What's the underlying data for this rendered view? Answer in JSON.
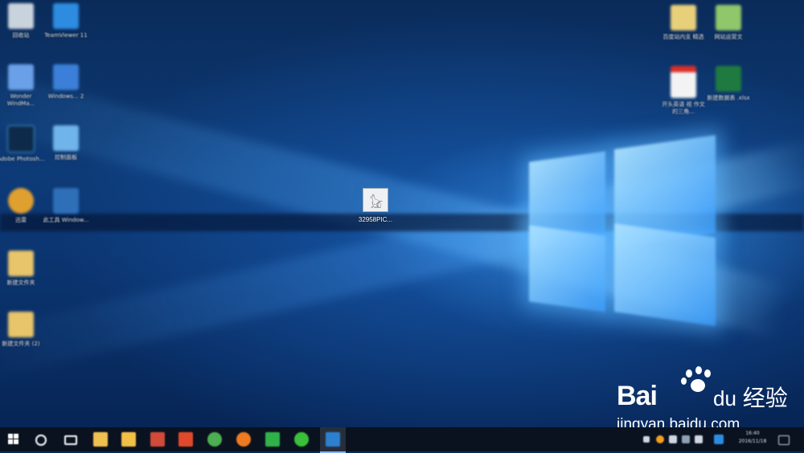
{
  "desktop": {
    "center_icon": {
      "label": "32958PIC..."
    },
    "left_icons": [
      {
        "label": "回收站",
        "icon": "recycle-bin-icon",
        "color": "#c9d3dd"
      },
      {
        "label": "TeamViewer 11",
        "icon": "teamviewer-icon",
        "color": "#2d8ce0"
      },
      {
        "label": "Wonder WindMa...",
        "icon": "app-icon",
        "color": "#6aa0e8"
      },
      {
        "label": "Windows... 2",
        "icon": "app-icon",
        "color": "#3b7fd8"
      },
      {
        "label": "Adobe Photosh...",
        "icon": "photoshop-icon",
        "color": "#0e2a4a"
      },
      {
        "label": "控制面板",
        "icon": "control-panel-icon",
        "color": "#6fb4ea"
      },
      {
        "label": "迅雷",
        "icon": "bird-icon",
        "color": "#e0a030"
      },
      {
        "label": "此工具 Window...",
        "icon": "app-icon",
        "color": "#2f6fb8"
      },
      {
        "label": "新建文件夹",
        "icon": "folder-icon",
        "color": "#e8c46a"
      },
      {
        "label": "新建文件夹 (2)",
        "icon": "folder-icon",
        "color": "#e8c46a"
      }
    ],
    "right_icons": [
      {
        "label": "百度站内支 精选",
        "icon": "file-icon",
        "color": "#e8cf7a"
      },
      {
        "label": "网站运营文",
        "icon": "file-icon",
        "color": "#8fc76a"
      },
      {
        "label": "开头英语 视 作文的三角...",
        "icon": "pdf-icon",
        "color": "#d8302a"
      },
      {
        "label": "新建数据表 .xlsx",
        "icon": "excel-icon",
        "color": "#1f7a40"
      }
    ]
  },
  "taskbar": {
    "apps": [
      {
        "name": "start-button",
        "color": "#ffffff"
      },
      {
        "name": "search-button",
        "color": "#ffffff"
      },
      {
        "name": "task-view-button",
        "color": "#ffffff"
      },
      {
        "name": "file-icon",
        "color": "#f0c050"
      },
      {
        "name": "explorer-icon",
        "color": "#f2c046"
      },
      {
        "name": "app-icon",
        "color": "#d24a3a"
      },
      {
        "name": "app-icon",
        "color": "#e04a2a"
      },
      {
        "name": "chrome-icon",
        "color": "#4caf50"
      },
      {
        "name": "firefox-icon",
        "color": "#f07a20"
      },
      {
        "name": "app-icon",
        "color": "#2fb24a"
      },
      {
        "name": "wechat-icon",
        "color": "#3bbf3b"
      },
      {
        "name": "photoshop-icon",
        "color": "#2d7fd0"
      }
    ],
    "clock_time": "16:40",
    "clock_date": "2016/11/18"
  },
  "watermark": {
    "brand": "Bai",
    "brand2": "du",
    "jingyan": "经验",
    "url": "jingyan.baidu.com"
  }
}
